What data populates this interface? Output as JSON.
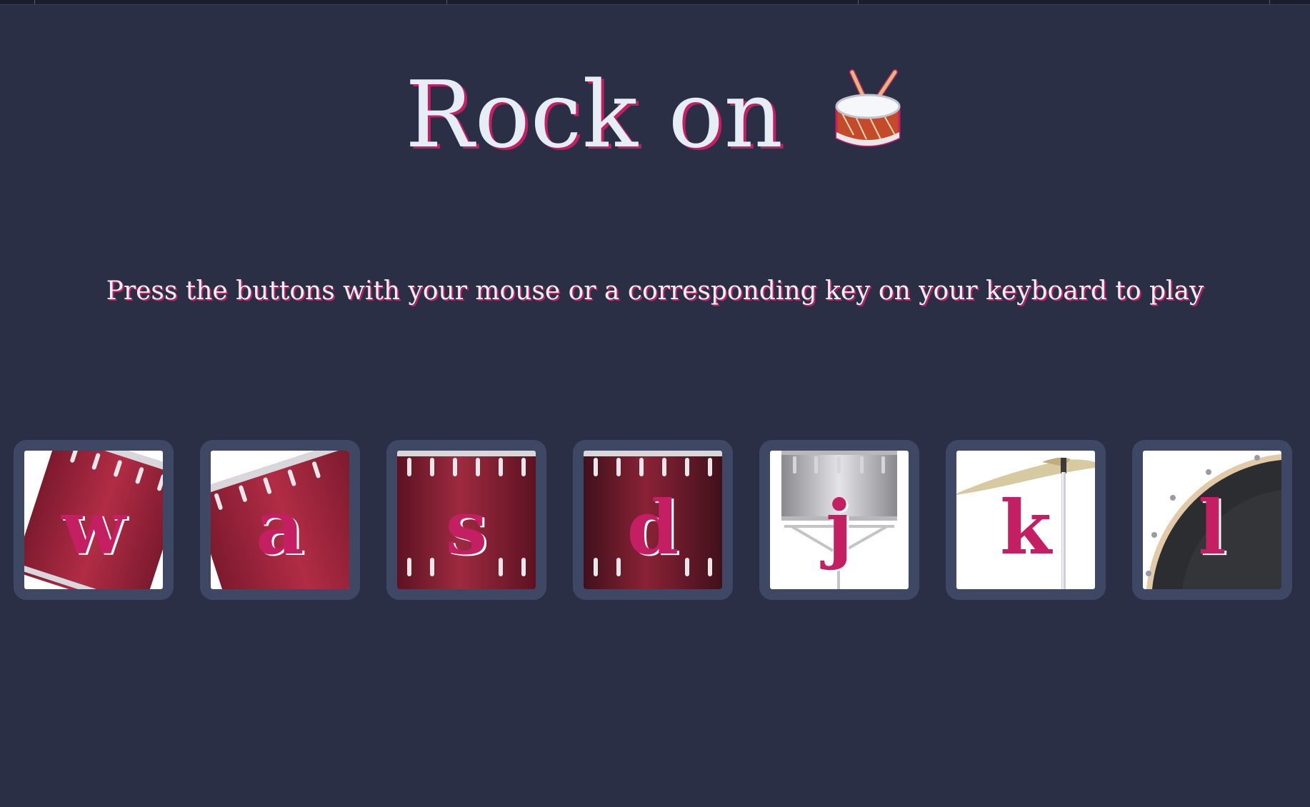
{
  "header": {
    "title": "Rock on",
    "title_icon": "drum-icon",
    "subtitle": "Press the buttons with your mouse or a corresponding key on your keyboard to play"
  },
  "pads": [
    {
      "key": "w",
      "instrument_icon": "tom-drum-icon"
    },
    {
      "key": "a",
      "instrument_icon": "tom-drum-icon"
    },
    {
      "key": "s",
      "instrument_icon": "floor-tom-icon"
    },
    {
      "key": "d",
      "instrument_icon": "floor-tom-icon"
    },
    {
      "key": "j",
      "instrument_icon": "snare-drum-icon"
    },
    {
      "key": "k",
      "instrument_icon": "cymbal-icon"
    },
    {
      "key": "l",
      "instrument_icon": "bass-drum-icon"
    }
  ],
  "colors": {
    "background": "#2a2f45",
    "accent": "#c41f63",
    "pad_border": "#3e4763",
    "text": "#e6eef5"
  }
}
